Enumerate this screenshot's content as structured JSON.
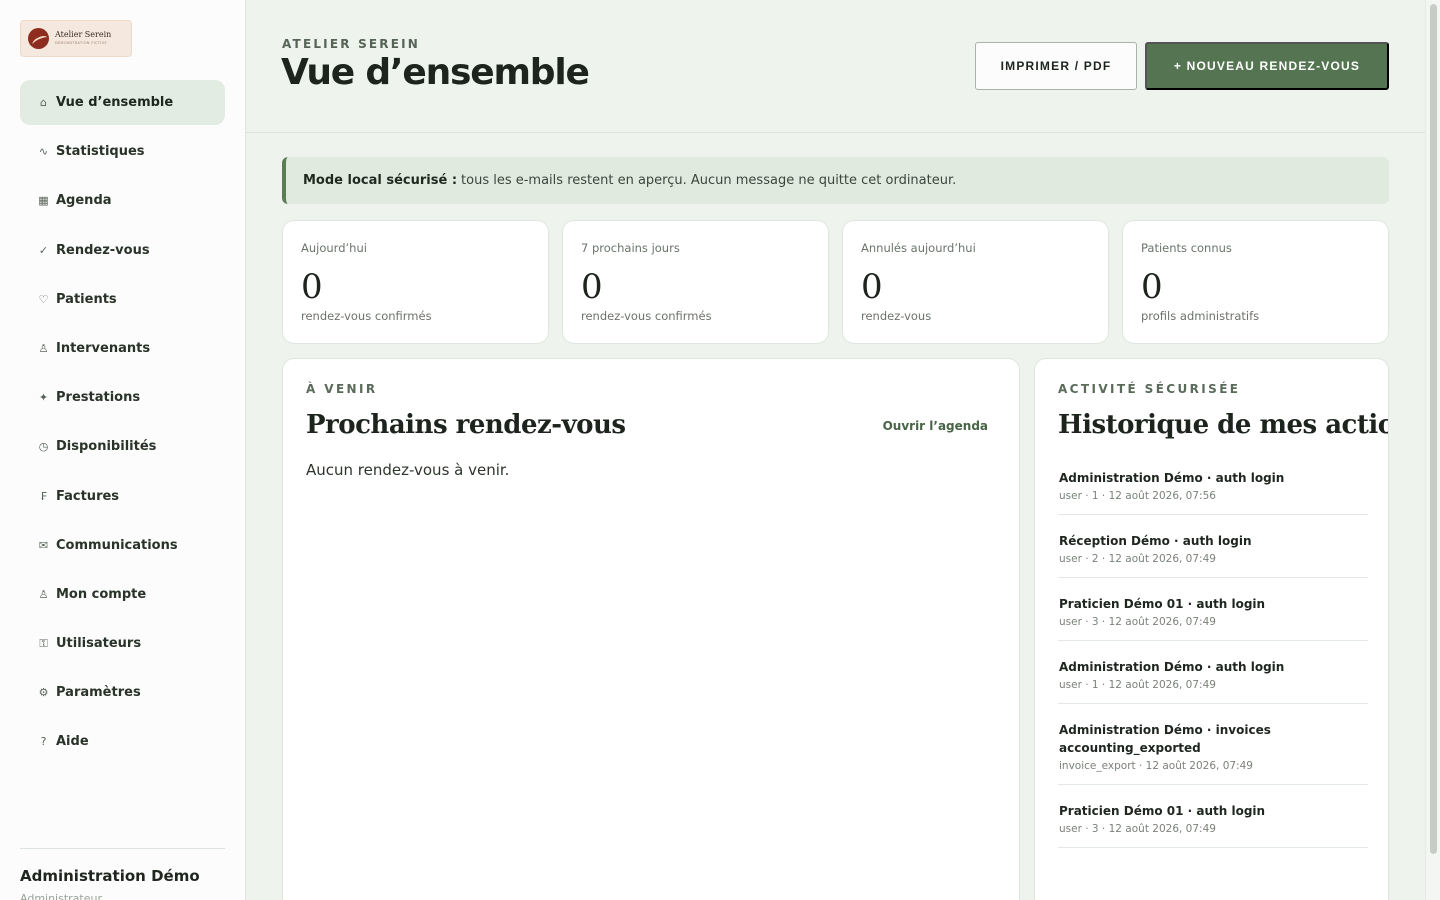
{
  "sidebar": {
    "logo": {
      "name": "Atelier Serein",
      "subtitle": "DÉMONSTRATION FICTIVE"
    },
    "items": [
      {
        "label": "Vue d’ensemble",
        "icon": "home-icon",
        "glyph": "⌂",
        "active": true
      },
      {
        "label": "Statistiques",
        "icon": "trend-icon",
        "glyph": "∿"
      },
      {
        "label": "Agenda",
        "icon": "calendar-icon",
        "glyph": "▦"
      },
      {
        "label": "Rendez-vous",
        "icon": "check-icon",
        "glyph": "✓"
      },
      {
        "label": "Patients",
        "icon": "heart-icon",
        "glyph": "♡"
      },
      {
        "label": "Intervenants",
        "icon": "person-icon",
        "glyph": "♙"
      },
      {
        "label": "Prestations",
        "icon": "sparkle-icon",
        "glyph": "✦"
      },
      {
        "label": "Disponibilités",
        "icon": "clock-icon",
        "glyph": "◷"
      },
      {
        "label": "Factures",
        "icon": "invoice-icon",
        "glyph": "₣"
      },
      {
        "label": "Communications",
        "icon": "mail-icon",
        "glyph": "✉"
      },
      {
        "label": "Mon compte",
        "icon": "account-icon",
        "glyph": "♙"
      },
      {
        "label": "Utilisateurs",
        "icon": "users-icon",
        "glyph": "⚿"
      },
      {
        "label": "Paramètres",
        "icon": "gear-icon",
        "glyph": "⚙"
      },
      {
        "label": "Aide",
        "icon": "help-icon",
        "glyph": "?"
      }
    ],
    "user": {
      "name": "Administration Démo",
      "role": "Administrateur"
    }
  },
  "header": {
    "eyebrow": "ATELIER SEREIN",
    "title": "Vue d’ensemble",
    "print_label": "IMPRIMER / PDF",
    "new_label": "+ NOUVEAU RENDEZ-VOUS"
  },
  "notice": {
    "bold": "Mode local sécurisé :",
    "text": "tous les e-mails restent en aperçu. Aucun message ne quitte cet ordinateur."
  },
  "stats": [
    {
      "label": "Aujourd’hui",
      "value": "0",
      "sub": "rendez-vous confirmés"
    },
    {
      "label": "7 prochains jours",
      "value": "0",
      "sub": "rendez-vous confirmés"
    },
    {
      "label": "Annulés aujourd’hui",
      "value": "0",
      "sub": "rendez-vous"
    },
    {
      "label": "Patients connus",
      "value": "0",
      "sub": "profils administratifs"
    }
  ],
  "upcoming": {
    "eyebrow": "À VENIR",
    "title": "Prochains rendez-vous",
    "link": "Ouvrir l’agenda",
    "empty": "Aucun rendez-vous à venir."
  },
  "activity": {
    "eyebrow": "ACTIVITÉ SÉCURISÉE",
    "title": "Historique de mes actions",
    "items": [
      {
        "title": "Administration Démo · auth login",
        "meta": "user · 1 · 12 août 2026, 07:56"
      },
      {
        "title": "Réception Démo · auth login",
        "meta": "user · 2 · 12 août 2026, 07:49"
      },
      {
        "title": "Praticien Démo 01 · auth login",
        "meta": "user · 3 · 12 août 2026, 07:49"
      },
      {
        "title": "Administration Démo · auth login",
        "meta": "user · 1 · 12 août 2026, 07:49"
      },
      {
        "title": "Administration Démo · invoices accounting_exported",
        "meta": "invoice_export · 12 août 2026, 07:49"
      },
      {
        "title": "Praticien Démo 01 · auth login",
        "meta": "user · 3 · 12 août 2026, 07:49"
      }
    ]
  },
  "colors": {
    "accent": "#557552",
    "background": "#eef3ee",
    "notice_bg": "#e1eadf",
    "active_nav_bg": "#e3ece2"
  }
}
